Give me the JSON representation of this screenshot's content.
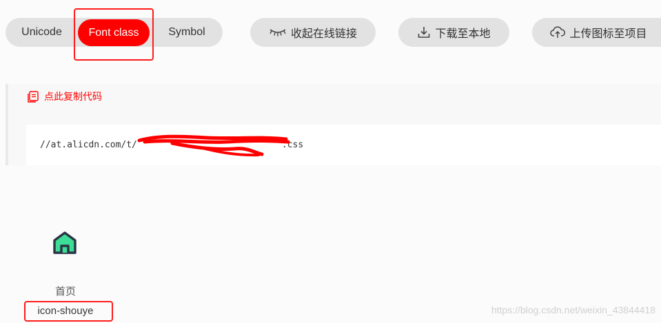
{
  "tabs": {
    "unicode": "Unicode",
    "font_class": "Font class",
    "symbol": "Symbol",
    "active": "font_class"
  },
  "actions": {
    "collapse": "收起在线链接",
    "download": "下载至本地",
    "upload": "上传图标至项目"
  },
  "code_panel": {
    "copy_label": "点此复制代码",
    "url_start": "//at.alicdn.com/t/",
    "url_end": ".css"
  },
  "icon": {
    "name": "首页",
    "class_name": "icon-shouye",
    "icon": "house-icon"
  },
  "watermark": "https://blog.csdn.net/weixin_43844418",
  "colors": {
    "accent": "#ff0000",
    "pill_bg": "#e2e2e2",
    "house_fill": "#3ddc97",
    "house_outline": "#2b3345"
  }
}
